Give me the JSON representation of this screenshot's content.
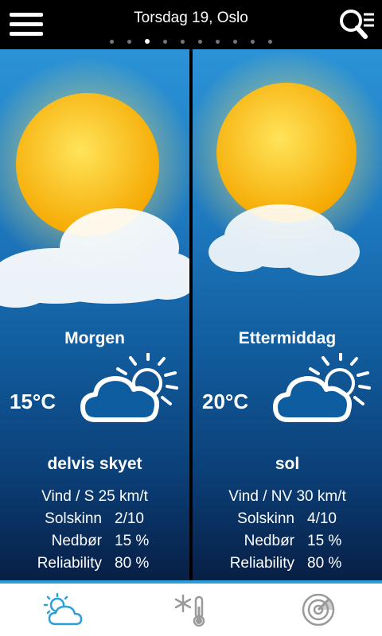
{
  "header": {
    "title": "Torsdag 19, Oslo",
    "page_count": 10,
    "active_page": 3
  },
  "panels": [
    {
      "period": "Morgen",
      "temperature": "15°C",
      "condition": "delvis skyet",
      "icon": "partly-cloudy-icon",
      "wind": "Vind / S 25 km/t",
      "stats": [
        {
          "label": "Solskinn",
          "value": "2/10"
        },
        {
          "label": "Nedbør",
          "value": "15 %"
        },
        {
          "label": "Reliability",
          "value": "80 %"
        }
      ]
    },
    {
      "period": "Ettermiddag",
      "temperature": "20°C",
      "condition": "sol",
      "icon": "partly-cloudy-icon",
      "wind": "Vind / NV 30 km/t",
      "stats": [
        {
          "label": "Solskinn",
          "value": "4/10"
        },
        {
          "label": "Nedbør",
          "value": "15 %"
        },
        {
          "label": "Reliability",
          "value": "80 %"
        }
      ]
    }
  ],
  "tabs": [
    {
      "name": "weather-tab",
      "icon": "cloud-sun-icon",
      "active": true
    },
    {
      "name": "thermometer-tab",
      "icon": "snowflake-thermometer-icon",
      "active": false
    },
    {
      "name": "radar-tab",
      "icon": "radar-icon",
      "active": false
    }
  ],
  "colors": {
    "accent": "#2aa0d8",
    "inactive_icon": "#9a9a9a"
  }
}
